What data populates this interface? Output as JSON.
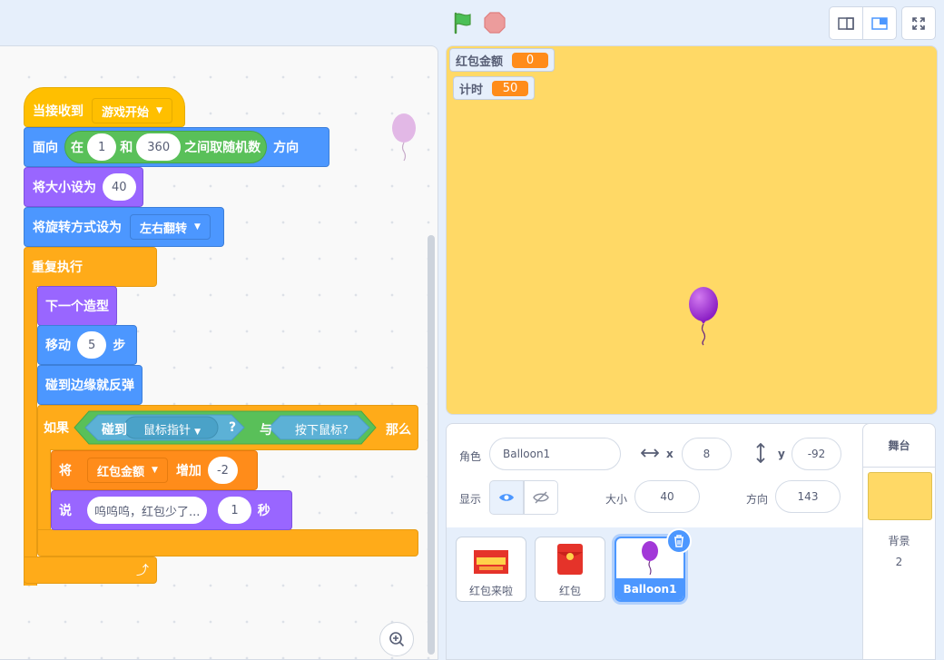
{
  "toolbar": {
    "green_flag": "green-flag-icon",
    "stop": "stop-icon"
  },
  "code": {
    "hat": {
      "label": "当接收到",
      "message": "游戏开始"
    },
    "point": {
      "label": "面向",
      "random_in": "在",
      "min": "1",
      "and": "和",
      "max": "360",
      "random_between": "之间取随机数",
      "suffix": "方向"
    },
    "size": {
      "label": "将大小设为",
      "value": "40"
    },
    "rotation": {
      "label": "将旋转方式设为",
      "value": "左右翻转"
    },
    "forever": {
      "label": "重复执行"
    },
    "next_costume": {
      "label": "下一个造型"
    },
    "move": {
      "label": "移动",
      "value": "5",
      "suffix": "步"
    },
    "bounce": {
      "label": "碰到边缘就反弹"
    },
    "if_block": {
      "label": "如果",
      "touching": "碰到",
      "target": "鼠标指针",
      "q": "?",
      "and": "与",
      "mouse_down": "按下鼠标?",
      "then": "那么"
    },
    "change": {
      "label": "将",
      "variable": "红包金额",
      "by": "增加",
      "value": "-2"
    },
    "say": {
      "label": "说",
      "message": "呜呜呜，红包少了...",
      "secs": "1",
      "suffix": "秒"
    }
  },
  "stage": {
    "monitors": [
      {
        "label": "红包金额",
        "value": "0"
      },
      {
        "label": "计时",
        "value": "50"
      }
    ]
  },
  "sprite_info": {
    "sprite_label": "角色",
    "sprite_name": "Balloon1",
    "x_label": "x",
    "x": "8",
    "y_label": "y",
    "y": "-92",
    "show_label": "显示",
    "size_label": "大小",
    "size": "40",
    "direction_label": "方向",
    "direction": "143"
  },
  "sprites": [
    {
      "name": "红包来啦",
      "selected": false
    },
    {
      "name": "红包",
      "selected": false
    },
    {
      "name": "Balloon1",
      "selected": true
    }
  ],
  "stage_pane": {
    "title": "舞台",
    "backdrops_label": "背景",
    "backdrops_count": "2"
  },
  "colors": {
    "accent": "#4c97ff",
    "stage_bg": "#ffd966",
    "events": "#ffbf00",
    "motion": "#4c97ff",
    "looks": "#9966ff",
    "control": "#ffab19",
    "sensing": "#5cb1d6",
    "operators": "#59c059",
    "variables": "#ff8c1a"
  }
}
